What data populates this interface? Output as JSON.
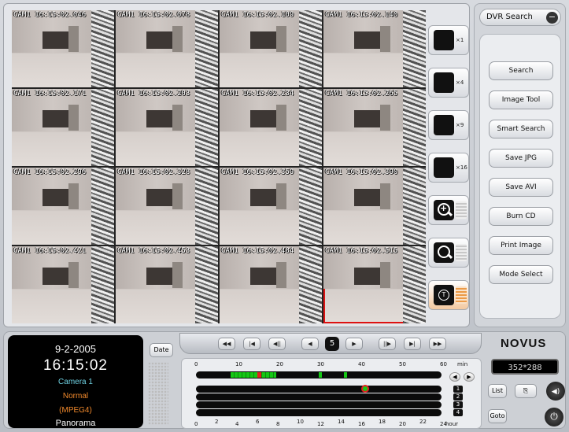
{
  "cameras": [
    {
      "stamp": "CAM1  16:15:02.046"
    },
    {
      "stamp": "CAM1  16:15:02.078"
    },
    {
      "stamp": "CAM1  16:15:02.109"
    },
    {
      "stamp": "CAM1  16:15:02.140"
    },
    {
      "stamp": "CAM1  16:15:02.171"
    },
    {
      "stamp": "CAM1  16:15:02.203"
    },
    {
      "stamp": "CAM1  16:15:02.234"
    },
    {
      "stamp": "CAM1  16:15:02.265"
    },
    {
      "stamp": "CAM1  16:15:02.296"
    },
    {
      "stamp": "CAM1  16:15:02.328"
    },
    {
      "stamp": "CAM1  16:15:02.359"
    },
    {
      "stamp": "CAM1  16:15:02.390"
    },
    {
      "stamp": "CAM1  16:15:02.421"
    },
    {
      "stamp": "CAM1  16:15:02.453"
    },
    {
      "stamp": "CAM1  16:15:02.484"
    },
    {
      "stamp": "CAM1  16:15:02.515"
    }
  ],
  "layout_buttons": {
    "x1": "×1",
    "x4": "×4",
    "x9": "×9",
    "x16": "×16"
  },
  "zoom_in_symbol": "+",
  "text_overlay_symbol": "T",
  "dvr": {
    "title": "DVR Search",
    "close_symbol": "−",
    "buttons": [
      "Search",
      "Image Tool",
      "Smart Search",
      "Save JPG",
      "Save AVI",
      "Burn CD",
      "Print Image",
      "Mode Select"
    ]
  },
  "info": {
    "date": "9-2-2005",
    "time": "16:15:02",
    "camera": "Camera 1",
    "mode": "Normal",
    "codec": "(MPEG4)",
    "view": "Panorama"
  },
  "date_button": "Date",
  "transport": {
    "rewind": "◀◀",
    "first": "|◀",
    "step_back": "◀||",
    "prev": "◀",
    "channel": "5",
    "next": "▶",
    "step_fwd": "||▶",
    "last": "▶|",
    "ffwd": "▶▶"
  },
  "timeline": {
    "min_ticks": [
      "0",
      "10",
      "20",
      "30",
      "40",
      "50",
      "60"
    ],
    "min_unit": "min",
    "hour_ticks": [
      "0",
      "2",
      "4",
      "6",
      "8",
      "10",
      "12",
      "14",
      "16",
      "18",
      "20",
      "22",
      "24"
    ],
    "hour_unit": "hour",
    "rows": [
      "1",
      "2",
      "3",
      "4"
    ],
    "left_arrow": "◀",
    "right_arrow": "▶"
  },
  "brand": "NOVUS",
  "resolution": "352*288",
  "list_button": "List",
  "goto_button": "Goto",
  "copy_icon": "⎘",
  "volume_icon": "◀)",
  "power_icon": "⏻",
  "colors": {
    "accent_green": "#14c814",
    "accent_red": "#e02020",
    "info_cyan": "#6fd2e3",
    "info_orange": "#f28a2c"
  }
}
